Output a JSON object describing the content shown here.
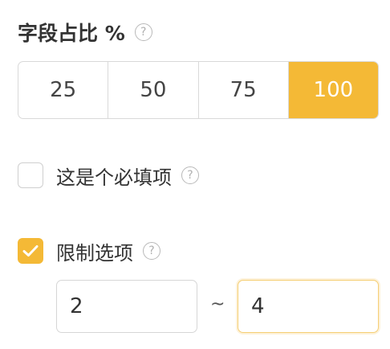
{
  "colors": {
    "accent": "#f4b936",
    "border": "#d9d9d9",
    "text": "#333333",
    "help_icon": "#b9b9b9"
  },
  "field_ratio": {
    "title": "字段占比 %",
    "help_icon": "question-circle-icon",
    "help_glyph": "?",
    "options": [
      "25",
      "50",
      "75",
      "100"
    ],
    "selected": "100"
  },
  "required": {
    "label": "这是个必填项",
    "checked": false,
    "help_glyph": "?"
  },
  "limit_options": {
    "label": "限制选项",
    "checked": true,
    "help_glyph": "?",
    "min_value": "2",
    "max_value": "4",
    "separator": "~"
  }
}
